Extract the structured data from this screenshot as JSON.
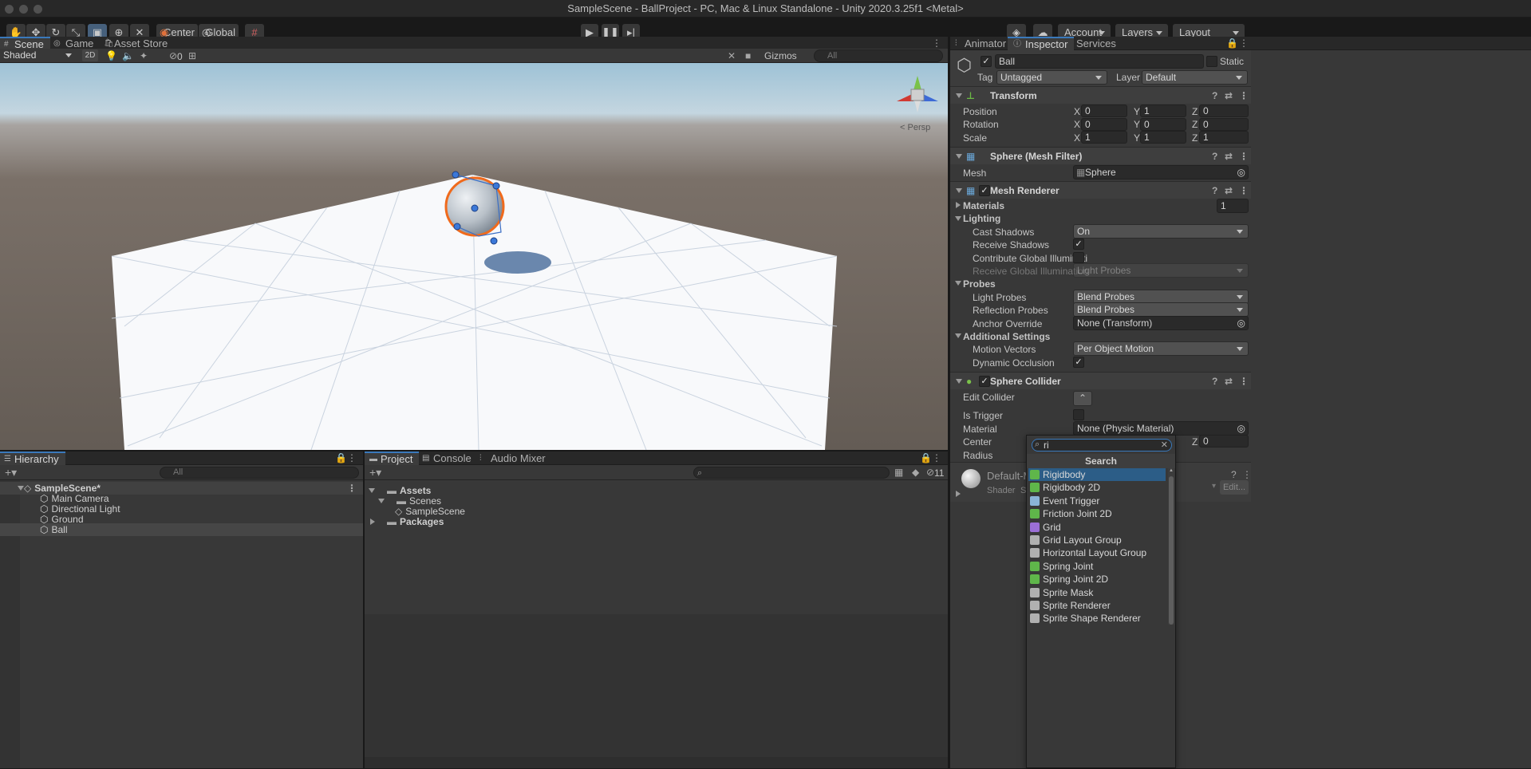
{
  "window": {
    "title": "SampleScene - BallProject - PC, Mac & Linux Standalone - Unity 2020.3.25f1 <Metal>"
  },
  "toolbar": {
    "pivot_mode": "Center",
    "pivot_rotation": "Global",
    "account": "Account",
    "layers": "Layers",
    "layout": "Layout"
  },
  "scene_panel": {
    "tabs": [
      "Scene",
      "Game",
      "Asset Store"
    ],
    "draw_mode": "Shaded",
    "mode_2d": "2D",
    "hidden_count": "0",
    "gizmos": "Gizmos",
    "search_placeholder": "All",
    "projection": "Persp"
  },
  "hierarchy": {
    "tab": "Hierarchy",
    "search_placeholder": "All",
    "scene": "SampleScene*",
    "items": [
      "Main Camera",
      "Directional Light",
      "Ground",
      "Ball"
    ]
  },
  "project": {
    "tabs": [
      "Project",
      "Console",
      "Audio Mixer"
    ],
    "hidden_count": "11",
    "tree": {
      "assets": "Assets",
      "scenes": "Scenes",
      "scene_file": "SampleScene",
      "packages": "Packages"
    }
  },
  "inspector": {
    "tabs": [
      "Animator",
      "Inspector",
      "Services"
    ],
    "object_name": "Ball",
    "static_label": "Static",
    "tag_label": "Tag",
    "tag_value": "Untagged",
    "layer_label": "Layer",
    "layer_value": "Default",
    "transform": {
      "title": "Transform",
      "rows": [
        {
          "label": "Position",
          "x": "0",
          "y": "1",
          "z": "0"
        },
        {
          "label": "Rotation",
          "x": "0",
          "y": "0",
          "z": "0"
        },
        {
          "label": "Scale",
          "x": "1",
          "y": "1",
          "z": "1"
        }
      ],
      "axis": {
        "x": "X",
        "y": "Y",
        "z": "Z"
      }
    },
    "mesh_filter": {
      "title": "Sphere (Mesh Filter)",
      "mesh_label": "Mesh",
      "mesh_value": "Sphere"
    },
    "mesh_renderer": {
      "title": "Mesh Renderer",
      "materials_label": "Materials",
      "materials_count": "1",
      "lighting_label": "Lighting",
      "cast_shadows_label": "Cast Shadows",
      "cast_shadows_value": "On",
      "receive_shadows_label": "Receive Shadows",
      "contribute_gi_label": "Contribute Global Illuminati",
      "receive_gi_label": "Receive Global Illumination",
      "receive_gi_value": "Light Probes",
      "probes_label": "Probes",
      "light_probes_label": "Light Probes",
      "light_probes_value": "Blend Probes",
      "reflection_probes_label": "Reflection Probes",
      "reflection_probes_value": "Blend Probes",
      "anchor_override_label": "Anchor Override",
      "anchor_override_value": "None (Transform)",
      "additional_label": "Additional Settings",
      "motion_vectors_label": "Motion Vectors",
      "motion_vectors_value": "Per Object Motion",
      "dynamic_occlusion_label": "Dynamic Occlusion"
    },
    "sphere_collider": {
      "title": "Sphere Collider",
      "edit_label": "Edit Collider",
      "is_trigger_label": "Is Trigger",
      "material_label": "Material",
      "material_value": "None (Physic Material)",
      "center_label": "Center",
      "center_z": "0",
      "radius_label": "Radius"
    },
    "material_preview": {
      "name": "Default-M",
      "shader_label": "Shader",
      "shader_value": "S",
      "edit_button": "Edit..."
    }
  },
  "add_component_popup": {
    "search_value": "ri",
    "header": "Search",
    "items": [
      {
        "label": "Rigidbody",
        "icon": "rigidbody-icon",
        "color": "#5fb64a"
      },
      {
        "label": "Rigidbody 2D",
        "icon": "rigidbody2d-icon",
        "color": "#5fb64a"
      },
      {
        "label": "Event Trigger",
        "icon": "event-trigger-icon",
        "color": "#8ab4d6"
      },
      {
        "label": "Friction Joint 2D",
        "icon": "joint-icon",
        "color": "#5fb64a"
      },
      {
        "label": "Grid",
        "icon": "grid-icon",
        "color": "#9b6fd6"
      },
      {
        "label": "Grid Layout Group",
        "icon": "grid-layout-icon",
        "color": "#b0b0b0"
      },
      {
        "label": "Horizontal Layout Group",
        "icon": "horizontal-layout-icon",
        "color": "#b0b0b0"
      },
      {
        "label": "Spring Joint",
        "icon": "spring-joint-icon",
        "color": "#5fb64a"
      },
      {
        "label": "Spring Joint 2D",
        "icon": "spring-joint2d-icon",
        "color": "#5fb64a"
      },
      {
        "label": "Sprite Mask",
        "icon": "sprite-mask-icon",
        "color": "#b0b0b0"
      },
      {
        "label": "Sprite Renderer",
        "icon": "sprite-renderer-icon",
        "color": "#b0b0b0"
      },
      {
        "label": "Sprite Shape Renderer",
        "icon": "sprite-shape-icon",
        "color": "#b0b0b0"
      }
    ]
  }
}
